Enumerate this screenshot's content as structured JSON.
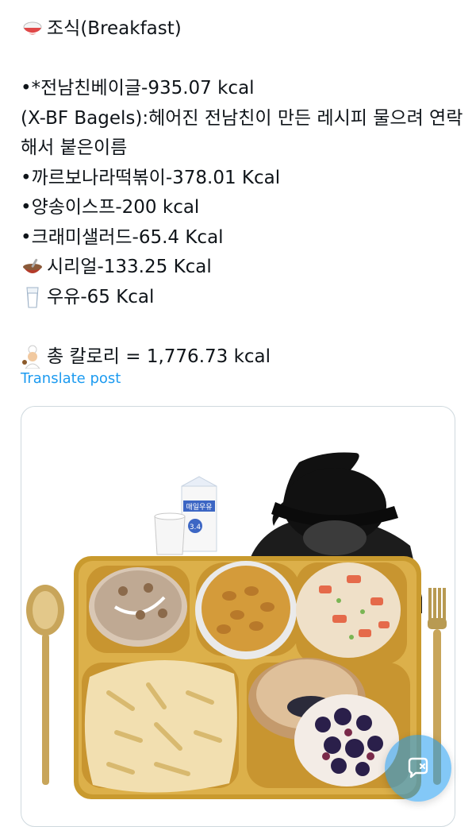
{
  "post": {
    "title": "조식(Breakfast)",
    "items": [
      "•*전남친베이글-935.07 kcal",
      "(X-BF Bagels):헤어진 전남친이 만든 레시피 물으려 연락해서 붙은이름",
      "•까르보나라떡볶이-378.01 Kcal",
      "•양송이스프-200 kcal",
      "•크래미샐러드-65.4 Kcal",
      "시리얼-133.25 Kcal",
      "우유-65 Kcal"
    ],
    "total": "총 칼로리  = 1,776.73 kcal"
  },
  "translate_label": "Translate post",
  "media": {
    "milk_carton_brand": "매일우유",
    "milk_carton_fat": "3.4"
  },
  "icons": {
    "title_emoji": "rice-bowl-icon",
    "cereal_emoji": "bowl-with-spoon-icon",
    "milk_emoji": "glass-of-milk-icon",
    "total_emoji": "chef-icon",
    "fab": "compose-message-icon"
  },
  "colors": {
    "link": "#1d9bf0",
    "text": "#0f1419",
    "border": "#cfd9de",
    "tray_gold": "#d6a93a"
  }
}
